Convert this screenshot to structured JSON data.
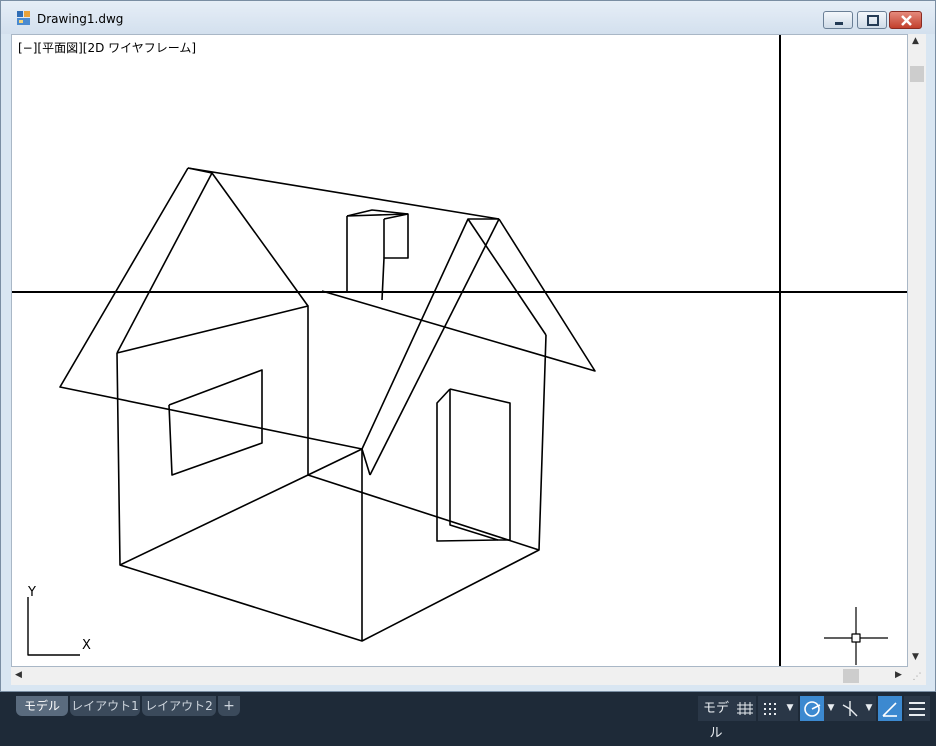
{
  "window": {
    "title": "Drawing1.dwg",
    "controls": {
      "minimize": "minimize",
      "maximize": "maximize",
      "close": "close"
    }
  },
  "viewport": {
    "label": "[−][平面図][2D ワイヤフレーム]",
    "ucs": {
      "x_label": "X",
      "y_label": "Y"
    },
    "background": "#ffffff",
    "line_color": "#000000"
  },
  "scrollbars": {
    "up": "^",
    "down": "v",
    "left": "<",
    "right": ">"
  },
  "tabs": [
    {
      "label": "モデル",
      "active": true
    },
    {
      "label": "レイアウト1",
      "active": false
    },
    {
      "label": "レイアウト2",
      "active": false
    }
  ],
  "tab_add": "+",
  "status_bar": {
    "model_label": "モデル",
    "buttons": [
      {
        "icon": "grid-icon",
        "active": false
      },
      {
        "icon": "snap-icon",
        "active": false
      },
      {
        "icon": "dropdown-icon",
        "active": false
      },
      {
        "icon": "polar-tracking-icon",
        "active": true
      },
      {
        "icon": "dropdown-icon",
        "active": false
      },
      {
        "icon": "isodraft-icon",
        "active": false
      },
      {
        "icon": "dropdown-icon",
        "active": false
      },
      {
        "icon": "object-snap-tracking-icon",
        "active": true
      },
      {
        "icon": "menu-icon",
        "active": false
      }
    ],
    "accent": "#3c89d0"
  }
}
